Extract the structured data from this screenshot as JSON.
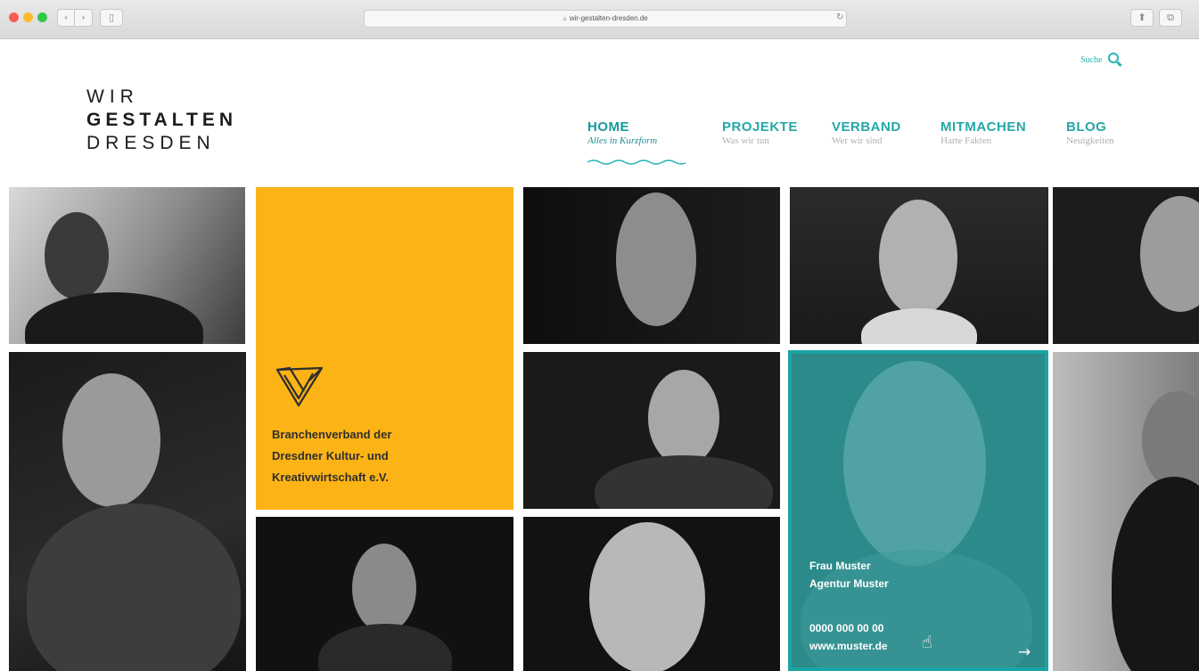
{
  "browser": {
    "url": "wir-gestalten-dresden.de",
    "lock_glyph": "⌂",
    "back_glyph": "‹",
    "forward_glyph": "›",
    "sidebar_glyph": "▯",
    "reload_glyph": "↻",
    "share_glyph": "⬆",
    "tabs_glyph": "⧉",
    "colors": {
      "close": "#fc5d55",
      "minimize": "#fdbc2e",
      "zoom": "#33c748"
    }
  },
  "logo": {
    "line1": "WIR",
    "line2": "GESTALTEN",
    "line3": "DRESDEN"
  },
  "search": {
    "label": "Suche",
    "icon": "search-icon"
  },
  "nav": [
    {
      "label": "HOME",
      "sub": "Alles in Kurzform",
      "active": true
    },
    {
      "label": "PROJEKTE",
      "sub": "Was wir tun",
      "active": false
    },
    {
      "label": "VERBAND",
      "sub": "Wer wir sind",
      "active": false
    },
    {
      "label": "MITMACHEN",
      "sub": "Harte Fakten",
      "active": false
    },
    {
      "label": "BLOG",
      "sub": "Neuigkeiten",
      "active": false
    }
  ],
  "brand_colors": {
    "teal": "#27b3b3",
    "yellow": "#fcb315",
    "dark": "#1c1c1c"
  },
  "yellow_tile": {
    "icon": "ribbon-logo-icon",
    "lines": [
      "Branchenverband der",
      "Dresdner Kultur- und",
      "Kreativwirtschaft e.V."
    ]
  },
  "contact_tile": {
    "name": "Frau Muster",
    "company": "Agentur Muster",
    "phone": "0000 000 00 00",
    "web": "www.muster.de",
    "arrow_glyph": "→",
    "cursor_glyph": "☝"
  }
}
